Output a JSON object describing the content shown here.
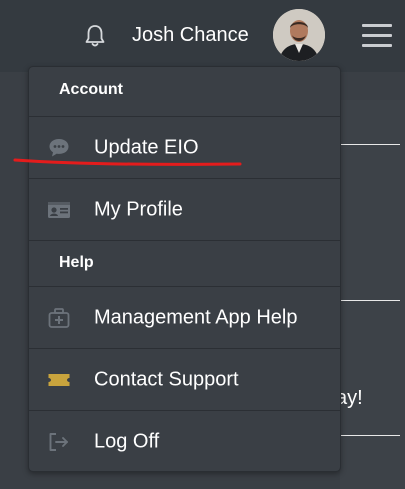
{
  "header": {
    "user_name": "Josh Chance",
    "icons": {
      "notifications": "bell-icon",
      "menu": "hamburger-menu-icon",
      "avatar": "user-avatar"
    }
  },
  "background": {
    "partial_text": "ay!"
  },
  "dropdown": {
    "sections": [
      {
        "title": "Account"
      },
      {
        "title": "Help"
      }
    ],
    "items": [
      {
        "label": "Update EIO",
        "icon": "chat-bubble-icon"
      },
      {
        "label": "My Profile",
        "icon": "id-card-icon"
      },
      {
        "label": "Management App Help",
        "icon": "first-aid-kit-icon"
      },
      {
        "label": "Contact Support",
        "icon": "ticket-icon"
      },
      {
        "label": "Log Off",
        "icon": "log-off-arrow-icon"
      }
    ]
  },
  "colors": {
    "background": "#3a3f45",
    "topbar": "#343a40",
    "text": "#ffffff",
    "icon": "#6c737b",
    "ticket": "#c9a43d",
    "annotation": "#e41c1c"
  }
}
